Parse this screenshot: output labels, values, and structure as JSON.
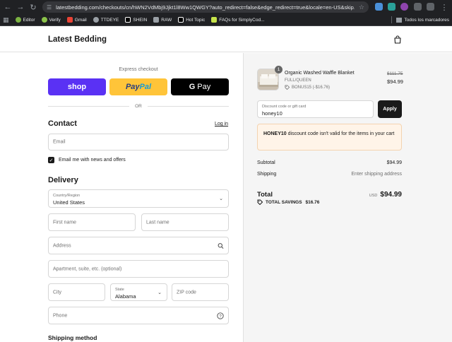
{
  "browser": {
    "url": "latestbedding.com/checkouts/cn/hWN2VdMbj9Jjkt1l8Ww1QWGY?auto_redirect=false&edge_redirect=true&locale=en-US&skip...",
    "bookmarks": [
      {
        "label": "Editor",
        "color": "#7cb342"
      },
      {
        "label": "Verify",
        "color": "#8bc34a"
      },
      {
        "label": "Gmail",
        "color": "#ea4335"
      },
      {
        "label": "TTDEYE",
        "color": "#9aa0a6"
      },
      {
        "label": "SHEIN",
        "color": "#000000"
      },
      {
        "label": "RAW",
        "color": "#9aa0a6"
      },
      {
        "label": "Hot Topic",
        "color": "#000000"
      },
      {
        "label": "FAQs for SimplyCod...",
        "color": "#c6e34a"
      }
    ],
    "bookmarks_right": "Todos los marcadores"
  },
  "header": {
    "brand": "Latest Bedding"
  },
  "express": {
    "title": "Express checkout",
    "shop_label": "shop",
    "paypal_label_1": "Pay",
    "paypal_label_2": "Pal",
    "gpay_g": "G",
    "gpay_label": "Pay",
    "or": "OR"
  },
  "contact": {
    "title": "Contact",
    "login": "Log in",
    "email_placeholder": "Email",
    "newsletter_label": "Email me with news and offers",
    "newsletter_checked": true
  },
  "delivery": {
    "title": "Delivery",
    "country_label": "Country/Region",
    "country_value": "United States",
    "first_name_placeholder": "First name",
    "last_name_placeholder": "Last name",
    "address_placeholder": "Address",
    "apartment_placeholder": "Apartment, suite, etc. (optional)",
    "city_placeholder": "City",
    "state_label": "State",
    "state_value": "Alabama",
    "zip_placeholder": "ZIP code",
    "phone_placeholder": "Phone"
  },
  "shipping_method": {
    "title": "Shipping method"
  },
  "order": {
    "item": {
      "quantity": "1",
      "name": "Organic Washed Waffle Blanket",
      "variant": "FULL/QUEEN",
      "discount": "BONUS15 (-$16.76)",
      "price_original": "$111.75",
      "price": "$94.99"
    },
    "discount_field": {
      "label": "Discount code or gift card",
      "value": "honey10"
    },
    "apply_label": "Apply",
    "notice_code": "HONEY10",
    "notice_text": " discount code isn't valid for the items in your cart",
    "subtotal_label": "Subtotal",
    "subtotal_value": "$94.99",
    "shipping_label": "Shipping",
    "shipping_value": "Enter shipping address",
    "total_label": "Total",
    "total_currency": "USD",
    "total_value": "$94.99",
    "savings_label": "TOTAL SAVINGS",
    "savings_value": "$16.76"
  }
}
